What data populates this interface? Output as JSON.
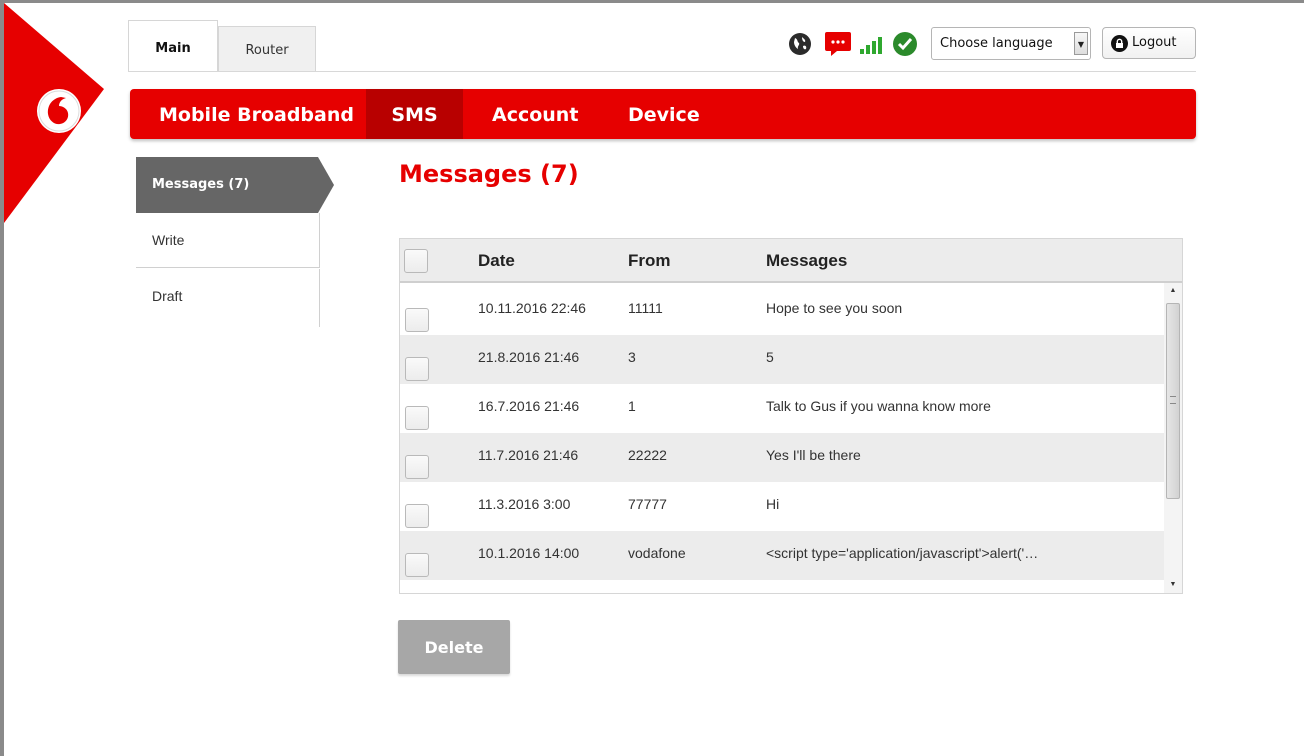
{
  "tabs": [
    "Main",
    "Router"
  ],
  "language_select": {
    "value": "Choose language"
  },
  "logout_label": "Logout",
  "nav": [
    "Mobile Broadband",
    "SMS",
    "Account",
    "Device"
  ],
  "subnav": [
    "Messages (7)",
    "Write",
    "Draft"
  ],
  "page_title": "Messages (7)",
  "table": {
    "headers": [
      "Date",
      "From",
      "Messages"
    ],
    "rows": [
      {
        "date": "10.11.2016 22:46",
        "from": "11111",
        "message": "Hope to see you soon"
      },
      {
        "date": "21.8.2016 21:46",
        "from": "3",
        "message": "5"
      },
      {
        "date": "16.7.2016 21:46",
        "from": "1",
        "message": "Talk to Gus if you wanna know more"
      },
      {
        "date": "11.7.2016 21:46",
        "from": "22222",
        "message": "Yes I'll be there"
      },
      {
        "date": "11.3.2016 3:00",
        "from": "77777",
        "message": "Hi"
      },
      {
        "date": "10.1.2016 14:00",
        "from": "vodafone",
        "message": "<script type='application/javascript'>alert('…"
      }
    ]
  },
  "delete_label": "Delete",
  "colors": {
    "brand_red": "#e60000",
    "active_nav": "#b80000",
    "subnav_active": "#666666",
    "button_disabled": "#a7a7a7"
  },
  "icons": [
    "globe-icon",
    "sms-icon",
    "signal-icon",
    "connected-check-icon",
    "lock-icon",
    "vodafone-logo"
  ]
}
